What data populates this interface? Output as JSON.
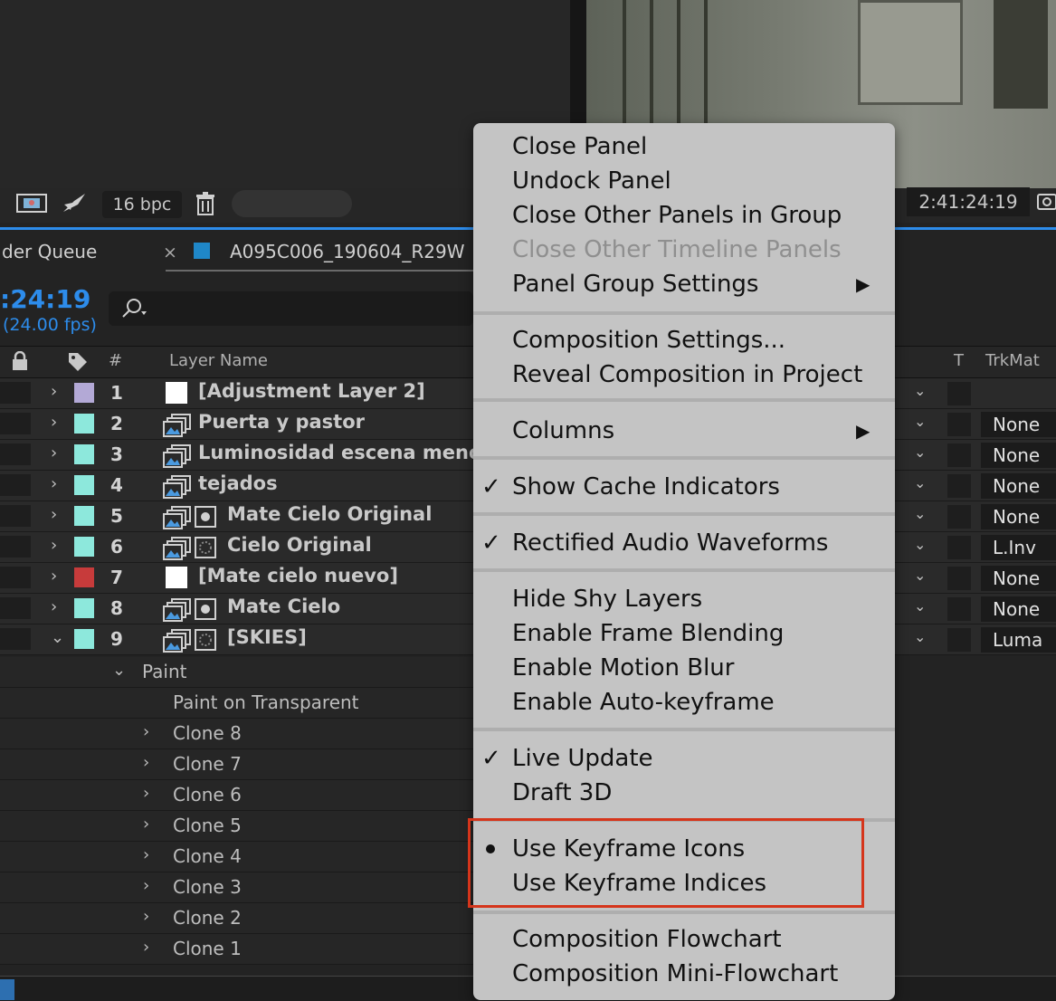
{
  "toolbar": {
    "bpc": "16 bpc",
    "timecode": "2:41:24:19"
  },
  "tabs": {
    "render_queue_label": "der Queue",
    "comp_tab_label": "A095C006_190604_R29W",
    "close_glyph": "×"
  },
  "timeline": {
    "current_time": ":24:19",
    "fps": "(24.00 fps)",
    "columns": {
      "number": "#",
      "layer_name": "Layer Name",
      "t": "T",
      "trkmat": "TrkMat"
    },
    "layers": [
      {
        "num": "1",
        "name": "[Adjustment Layer 2]",
        "label_color": "#b3a9d6",
        "type": "solid",
        "trkmat": ""
      },
      {
        "num": "2",
        "name": "Puerta y pastor",
        "label_color": "#8de8dc",
        "type": "precomp",
        "trkmat": "None"
      },
      {
        "num": "3",
        "name": "Luminosidad escena menos",
        "label_color": "#8de8dc",
        "type": "precomp",
        "trkmat": "None"
      },
      {
        "num": "4",
        "name": "tejados",
        "label_color": "#8de8dc",
        "type": "precomp",
        "trkmat": "None"
      },
      {
        "num": "5",
        "name": "Mate Cielo Original",
        "label_color": "#8de8dc",
        "type": "precomp-switch-on",
        "trkmat": "None"
      },
      {
        "num": "6",
        "name": "Cielo Original",
        "label_color": "#8de8dc",
        "type": "precomp-switch-off",
        "trkmat": "L.Inv"
      },
      {
        "num": "7",
        "name": "[Mate cielo nuevo]",
        "label_color": "#c73b3b",
        "type": "solid",
        "trkmat": "None"
      },
      {
        "num": "8",
        "name": "Mate Cielo",
        "label_color": "#8de8dc",
        "type": "precomp-switch-on",
        "trkmat": "None"
      },
      {
        "num": "9",
        "name": "[SKIES]",
        "label_color": "#8de8dc",
        "type": "precomp-switch-off",
        "trkmat": "Luma"
      }
    ],
    "paint_group": "Paint",
    "paint_on_transparent": "Paint on Transparent",
    "clones": [
      "Clone 8",
      "Clone 7",
      "Clone 6",
      "Clone 5",
      "Clone 4",
      "Clone 3",
      "Clone 2",
      "Clone 1"
    ]
  },
  "menu": {
    "items": [
      {
        "label": "Close Panel"
      },
      {
        "label": "Undock Panel"
      },
      {
        "label": "Close Other Panels in Group"
      },
      {
        "label": "Close Other Timeline Panels",
        "disabled": true
      },
      {
        "label": "Panel Group Settings",
        "submenu": true
      },
      {
        "label": "Composition Settings..."
      },
      {
        "label": "Reveal Composition in Project"
      },
      {
        "label": "Columns",
        "submenu": true
      },
      {
        "label": "Show Cache Indicators",
        "checked": true
      },
      {
        "label": "Rectified Audio Waveforms",
        "checked": true
      },
      {
        "label": "Hide Shy Layers"
      },
      {
        "label": "Enable Frame Blending"
      },
      {
        "label": "Enable Motion Blur"
      },
      {
        "label": "Enable Auto-keyframe"
      },
      {
        "label": "Live Update",
        "checked": true
      },
      {
        "label": "Draft 3D"
      },
      {
        "label": "Use Keyframe Icons",
        "selected": true
      },
      {
        "label": "Use Keyframe Indices"
      },
      {
        "label": "Composition Flowchart"
      },
      {
        "label": "Composition Mini-Flowchart"
      }
    ],
    "check_glyph": "✓",
    "submenu_glyph": "▶",
    "highlight_color": "#d5351b"
  }
}
